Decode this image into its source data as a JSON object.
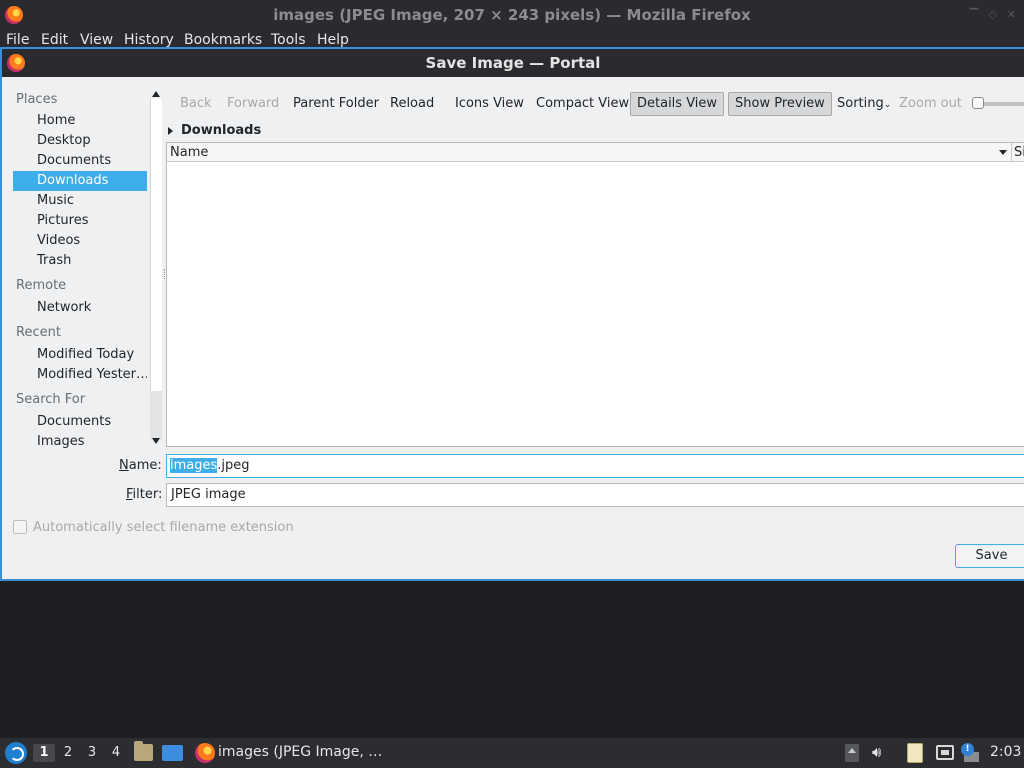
{
  "firefox": {
    "window_title": "images (JPEG Image, 207 × 243 pixels) — Mozilla Firefox",
    "menu": [
      "File",
      "Edit",
      "View",
      "History",
      "Bookmarks",
      "Tools",
      "Help"
    ]
  },
  "dialog": {
    "title": "Save Image — Portal",
    "sidebar": {
      "places_header": "Places",
      "places": [
        "Home",
        "Desktop",
        "Documents",
        "Downloads",
        "Music",
        "Pictures",
        "Videos",
        "Trash"
      ],
      "selected": "Downloads",
      "remote_header": "Remote",
      "remote": [
        "Network"
      ],
      "recent_header": "Recent",
      "recent": [
        "Modified Today",
        "Modified Yester…"
      ],
      "search_header": "Search For",
      "search": [
        "Documents",
        "Images"
      ]
    },
    "toolbar": {
      "back": "Back",
      "forward": "Forward",
      "parent_folder": "Parent Folder",
      "reload": "Reload",
      "icons_view": "Icons View",
      "compact_view": "Compact View",
      "details_view": "Details View",
      "show_preview": "Show Preview",
      "sorting": "Sorting",
      "zoom_out": "Zoom out"
    },
    "breadcrumb": "Downloads",
    "columns": {
      "name": "Name",
      "size": "Size"
    },
    "name_label_prefix": "N",
    "name_label_rest": "ame:",
    "name_value_selected": "images",
    "name_value_rest": ".jpeg",
    "filter_label_prefix": "F",
    "filter_label_rest": "ilter:",
    "filter_value": "JPEG image",
    "auto_extension_label": "Automatically select filename extension",
    "save_button": "Save"
  },
  "taskbar": {
    "desktops": [
      "1",
      "2",
      "3",
      "4"
    ],
    "active_desktop": "1",
    "task_label": "images (JPEG Image, …",
    "clock": "2:03"
  }
}
